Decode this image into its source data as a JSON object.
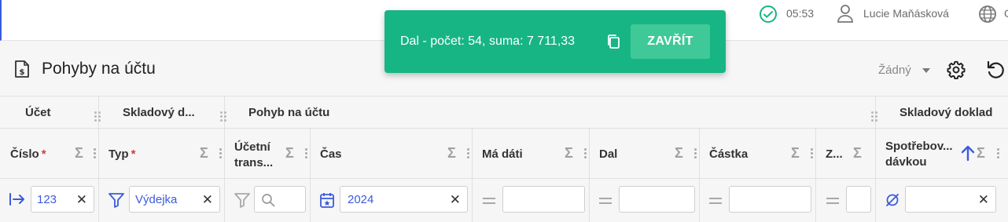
{
  "topbar": {
    "time": "05:53",
    "user_name": "Lucie Maňásková",
    "lang": "C"
  },
  "page": {
    "title": "Pohyby na účtu",
    "preset": "Žádný"
  },
  "grid": {
    "groups": [
      "Účet",
      "Skladový d...",
      "Pohyb na účtu",
      "Skladový doklad"
    ],
    "columns": [
      {
        "label": "Číslo",
        "required": "*"
      },
      {
        "label": "Typ",
        "required": "*"
      },
      {
        "label": "Účetní trans..."
      },
      {
        "label": "Čas"
      },
      {
        "label": "Má dáti"
      },
      {
        "label": "Dal"
      },
      {
        "label": "Částka"
      },
      {
        "label": "Z..."
      },
      {
        "label": "Spotřebov... dávkou"
      }
    ],
    "sigma": "Σ",
    "filters": {
      "cislo": "123",
      "typ": "Výdejka",
      "cas": "2024"
    },
    "clear_symbol": "✕"
  },
  "toast": {
    "message": "Dal - počet: 54, suma: 7 711,33",
    "close_label": "ZAVŘÍT"
  },
  "colors": {
    "toast_bg": "#17b584",
    "toast_button": "#3fc999",
    "accent": "#3b5bdb",
    "required": "#d63939"
  }
}
